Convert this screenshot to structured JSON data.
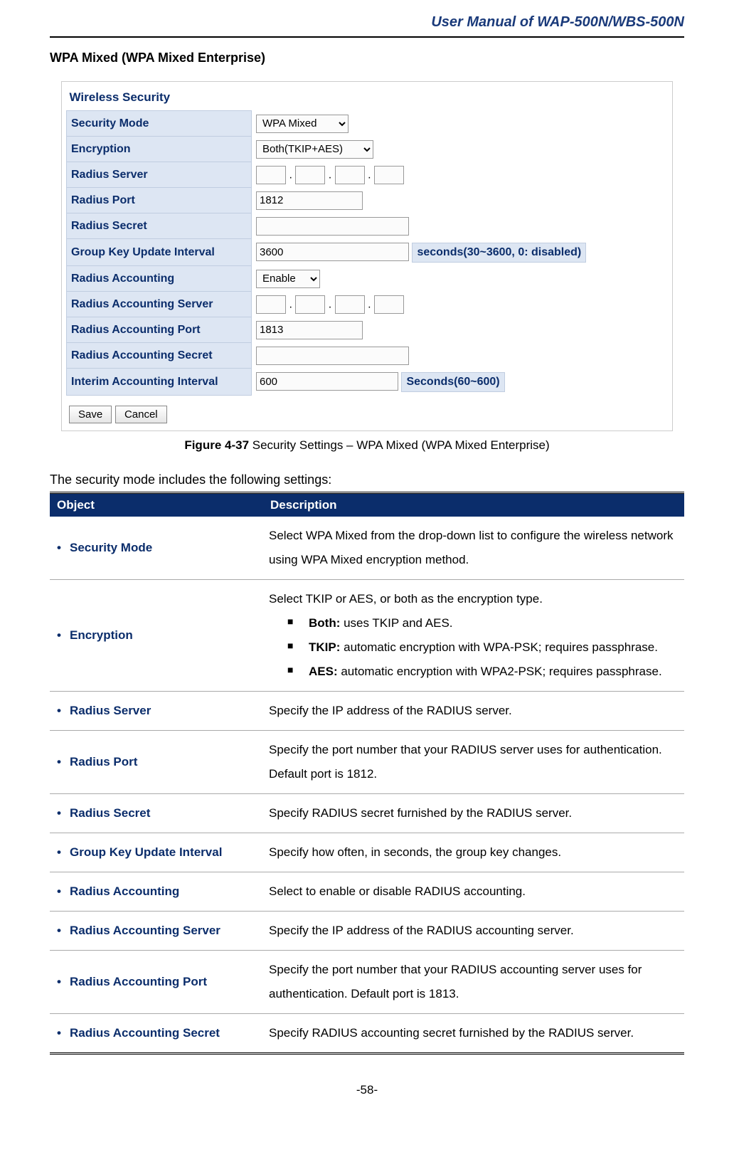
{
  "header": {
    "doc_title": "User Manual of WAP-500N/WBS-500N"
  },
  "section": {
    "title": "WPA Mixed (WPA Mixed Enterprise)"
  },
  "shot": {
    "panel_title": "Wireless Security",
    "rows": {
      "security_mode": {
        "label": "Security Mode",
        "value": "WPA Mixed"
      },
      "encryption": {
        "label": "Encryption",
        "value": "Both(TKIP+AES)"
      },
      "radius_server": {
        "label": "Radius Server"
      },
      "radius_port": {
        "label": "Radius Port",
        "value": "1812"
      },
      "radius_secret": {
        "label": "Radius Secret",
        "value": ""
      },
      "group_key": {
        "label": "Group Key Update Interval",
        "value": "3600",
        "suffix": "seconds(30~3600, 0: disabled)"
      },
      "radius_acct": {
        "label": "Radius Accounting",
        "value": "Enable"
      },
      "acct_server": {
        "label": "Radius Accounting Server"
      },
      "acct_port": {
        "label": "Radius Accounting Port",
        "value": "1813"
      },
      "acct_secret": {
        "label": "Radius Accounting Secret",
        "value": ""
      },
      "interim": {
        "label": "Interim Accounting Interval",
        "value": "600",
        "suffix": "Seconds(60~600)"
      }
    },
    "buttons": {
      "save": "Save",
      "cancel": "Cancel"
    }
  },
  "figure": {
    "label": "Figure 4-37",
    "caption": " Security Settings – WPA Mixed (WPA Mixed Enterprise)"
  },
  "intro": "The security mode includes the following settings:",
  "table": {
    "head": {
      "object": "Object",
      "desc": "Description"
    },
    "rows": [
      {
        "object": "Security Mode",
        "desc_plain": "Select WPA Mixed from the drop-down list to configure the wireless network using WPA Mixed encryption method."
      },
      {
        "object": "Encryption",
        "desc_intro": "Select TKIP or AES, or both as the encryption type.",
        "sub": [
          {
            "b": "Both:",
            "t": " uses TKIP and AES."
          },
          {
            "b": "TKIP:",
            "t": " automatic encryption with WPA-PSK; requires passphrase."
          },
          {
            "b": "AES:",
            "t": " automatic encryption with WPA2-PSK; requires passphrase."
          }
        ]
      },
      {
        "object": "Radius Server",
        "desc_plain": "Specify the IP address of the RADIUS server."
      },
      {
        "object": "Radius Port",
        "desc_plain": "Specify the port number that your RADIUS server uses for authentication. Default port is 1812."
      },
      {
        "object": "Radius Secret",
        "desc_plain": "Specify RADIUS secret furnished by the RADIUS server."
      },
      {
        "object": "Group Key Update Interval",
        "desc_plain": "Specify how often, in seconds, the group key changes."
      },
      {
        "object": "Radius Accounting",
        "desc_plain": "Select to enable or disable RADIUS accounting."
      },
      {
        "object": "Radius Accounting Server",
        "desc_plain": "Specify the IP address of the RADIUS accounting server."
      },
      {
        "object": "Radius Accounting Port",
        "desc_plain": "Specify the port number that your RADIUS accounting server uses for authentication. Default port is 1813."
      },
      {
        "object": "Radius Accounting Secret",
        "desc_plain": "Specify RADIUS accounting secret furnished by the RADIUS server."
      }
    ]
  },
  "page_number": "-58-"
}
